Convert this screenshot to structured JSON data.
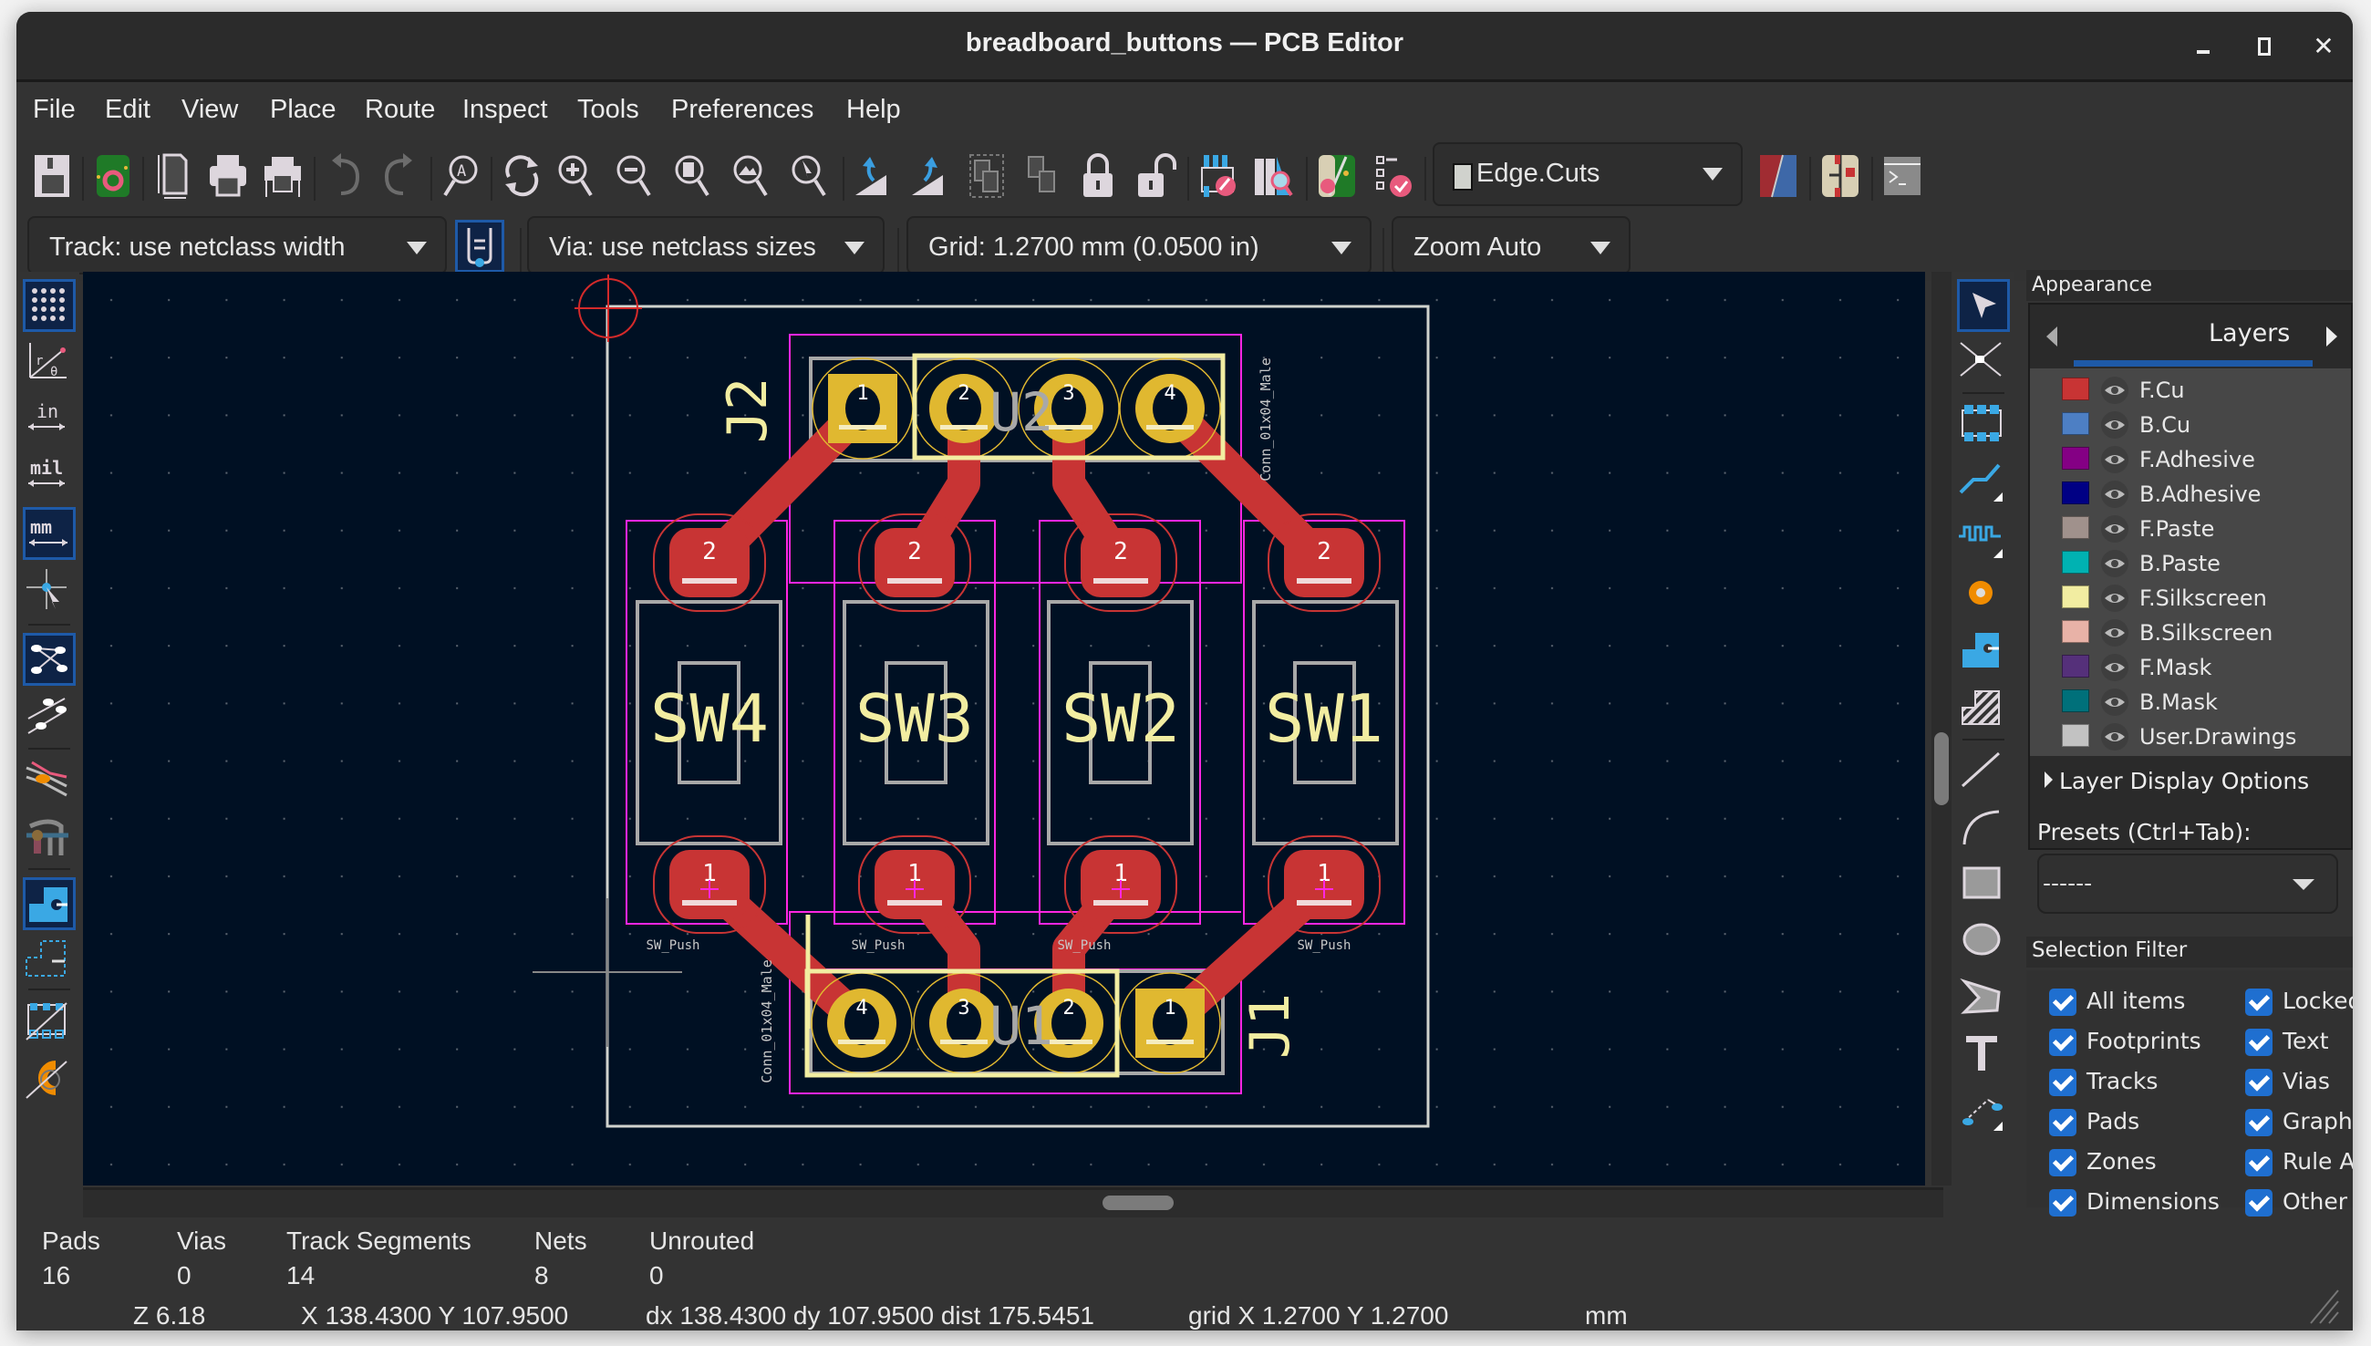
{
  "window": {
    "title": "breadboard_buttons — PCB Editor",
    "controls": {
      "minimize": "minimize-icon",
      "maximize": "maximize-icon",
      "close": "close-icon"
    }
  },
  "menu": [
    "File",
    "Edit",
    "View",
    "Place",
    "Route",
    "Inspect",
    "Tools",
    "Preferences",
    "Help"
  ],
  "toolbar": {
    "icons": [
      "save",
      "board-setup",
      "page-settings",
      "print",
      "plot",
      "undo",
      "redo",
      "find",
      "redraw",
      "zoom-in",
      "zoom-out",
      "zoom-fit",
      "zoom-fit-objects",
      "zoom-selection",
      "rotate-ccw",
      "rotate-cw",
      "group",
      "ungroup",
      "lock",
      "unlock",
      "update-pcb-from-schematic",
      "show-footprint-browser",
      "net-inspector",
      "design-rules-checker",
      "layer-pair",
      "switch-to-schematic",
      "scripting-console"
    ],
    "layer_select": "Edge.Cuts",
    "layer_swatch_color": "#d0d2cd"
  },
  "toolbar2": {
    "track": "Track: use netclass width",
    "via": "Via: use netclass sizes",
    "grid": "Grid: 1.2700 mm (0.0500 in)",
    "zoom": "Zoom Auto"
  },
  "left_toolbar": [
    {
      "name": "toggle-grid",
      "active": true
    },
    {
      "name": "polar-coordinates",
      "active": false
    },
    {
      "name": "units-inches",
      "label": "in",
      "active": false
    },
    {
      "name": "units-mils",
      "label": "mil",
      "active": false
    },
    {
      "name": "units-mm",
      "label": "mm",
      "active": true
    },
    {
      "name": "full-crosshair",
      "active": false
    },
    {
      "name": "show-ratsnest",
      "active": true
    },
    {
      "name": "curved-ratsnest",
      "active": false
    },
    {
      "name": "net-color-mode",
      "active": false
    },
    {
      "name": "high-contrast",
      "active": false
    },
    {
      "name": "show-pads-filled",
      "active": true
    },
    {
      "name": "show-pads-outline",
      "active": false
    },
    {
      "name": "show-footprints-outline",
      "active": false
    },
    {
      "name": "show-vias-outline",
      "active": false
    }
  ],
  "right_toolbar": [
    "select",
    "local-ratsnest",
    "add-footprint",
    "route-track",
    "tune-length",
    "add-via",
    "add-zone",
    "add-rule-area",
    "draw-line",
    "draw-arc",
    "draw-rectangle",
    "draw-circle",
    "draw-polygon",
    "add-text",
    "add-dimension"
  ],
  "appearance": {
    "title": "Appearance",
    "tab": "Layers",
    "layers": [
      {
        "name": "F.Cu",
        "color": "#c83434"
      },
      {
        "name": "B.Cu",
        "color": "#4d7fc4"
      },
      {
        "name": "F.Adhesive",
        "color": "#840084"
      },
      {
        "name": "B.Adhesive",
        "color": "#000084"
      },
      {
        "name": "F.Paste",
        "color": "#a0918c"
      },
      {
        "name": "B.Paste",
        "color": "#00b2b2"
      },
      {
        "name": "F.Silkscreen",
        "color": "#f2eda1"
      },
      {
        "name": "B.Silkscreen",
        "color": "#e8b2a7"
      },
      {
        "name": "F.Mask",
        "color": "#55307a"
      },
      {
        "name": "B.Mask",
        "color": "#00707a"
      },
      {
        "name": "User.Drawings",
        "color": "#c2c2c2"
      }
    ],
    "layer_display_options": "Layer Display Options",
    "presets_label": "Presets (Ctrl+Tab):",
    "presets_value": "------",
    "selection_filter_title": "Selection Filter",
    "selection_filter": [
      {
        "label": "All items",
        "checked": true
      },
      {
        "label": "Locked",
        "checked": true
      },
      {
        "label": "Footprints",
        "checked": true
      },
      {
        "label": "Text",
        "checked": true
      },
      {
        "label": "Tracks",
        "checked": true
      },
      {
        "label": "Vias",
        "checked": true
      },
      {
        "label": "Pads",
        "checked": true
      },
      {
        "label": "Graphic",
        "checked": true
      },
      {
        "label": "Zones",
        "checked": true
      },
      {
        "label": "Rule Ar",
        "checked": true
      },
      {
        "label": "Dimensions",
        "checked": true
      },
      {
        "label": "Other it",
        "checked": true
      }
    ]
  },
  "board": {
    "references": {
      "J2": "J2",
      "J1": "J1",
      "U2": "U2",
      "U1": "U1",
      "SW4": "SW4",
      "SW3": "SW3",
      "SW2": "SW2",
      "SW1": "SW1"
    },
    "connector_value": "Conn_01x04_Male",
    "switch_value": "SW_Push",
    "pad_numbers": {
      "j2": [
        "1",
        "2",
        "3",
        "4"
      ],
      "j1": [
        "4",
        "3",
        "2",
        "1"
      ],
      "sw_top": "2",
      "sw_bottom": "1"
    }
  },
  "status": {
    "stats": [
      {
        "label": "Pads",
        "value": "16"
      },
      {
        "label": "Vias",
        "value": "0"
      },
      {
        "label": "Track Segments",
        "value": "14"
      },
      {
        "label": "Nets",
        "value": "8"
      },
      {
        "label": "Unrouted",
        "value": "0"
      }
    ],
    "zoom": "Z 6.18",
    "cursor": "X 138.4300  Y 107.9500",
    "delta": "dx 138.4300  dy 107.9500  dist 175.5451",
    "grid": "grid X 1.2700  Y 1.2700",
    "units": "mm"
  }
}
